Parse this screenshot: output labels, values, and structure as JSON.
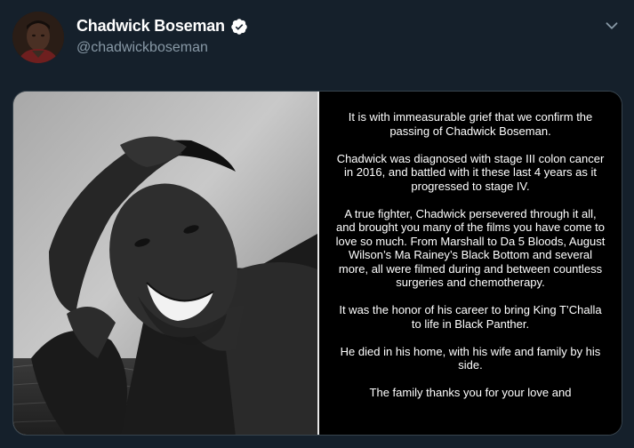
{
  "tweet": {
    "display_name": "Chadwick Boseman",
    "handle": "@chadwickboseman",
    "verified_icon": "verified-badge-icon",
    "menu_icon": "chevron-down-icon"
  },
  "media": {
    "photo_icon": "portrait-photo",
    "statement": [
      "It is with immeasurable grief that we confirm the passing of Chadwick Boseman.",
      "Chadwick was diagnosed with stage III colon cancer in 2016, and battled with it these last 4 years as it progressed to stage IV.",
      "A true fighter, Chadwick persevered through it all, and brought you many of the films you have come to love so much. From Marshall to Da 5 Bloods, August Wilson’s Ma Rainey’s Black Bottom and several more, all were filmed during and between countless surgeries and chemotherapy.",
      "It was the honor of his career to bring King T’Challa to life in Black Panther.",
      "He died in his home, with his wife and family by his side.",
      "The family thanks you for your love and"
    ]
  },
  "colors": {
    "background": "#15202b",
    "secondary_text": "#8899a6",
    "border": "#38444d"
  }
}
